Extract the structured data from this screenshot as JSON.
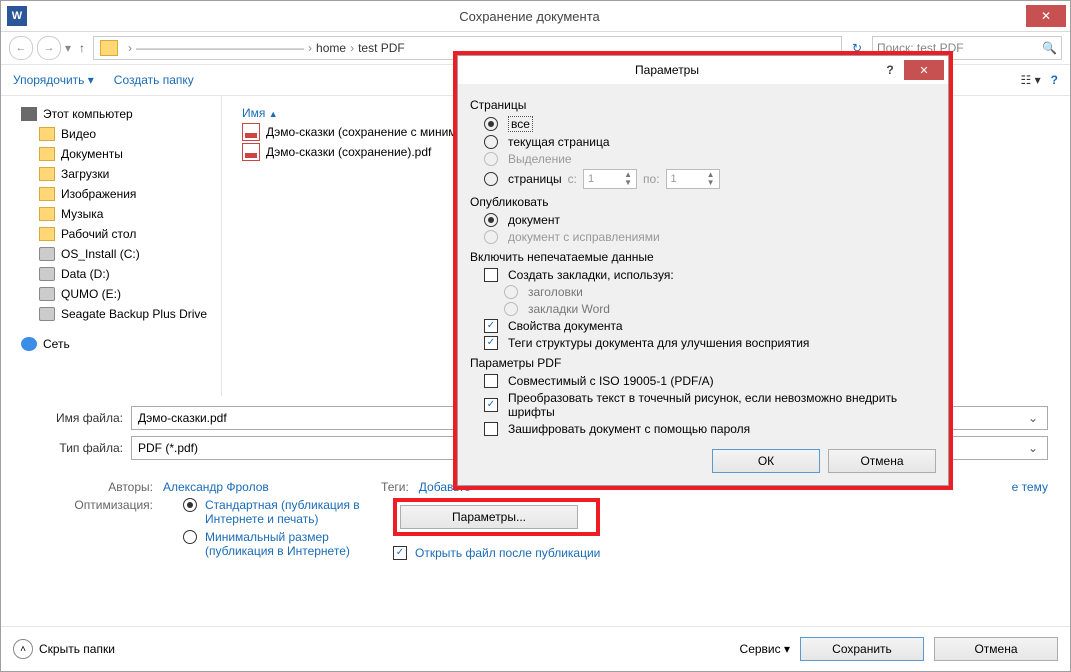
{
  "window": {
    "title": "Сохранение документа"
  },
  "nav": {
    "path_crumbs": [
      "home",
      "test PDF"
    ],
    "search_placeholder": "Поиск: test PDF"
  },
  "toolbar": {
    "organize": "Упорядочить",
    "new_folder": "Создать папку"
  },
  "tree": {
    "root": "Этот компьютер",
    "items": [
      "Видео",
      "Документы",
      "Загрузки",
      "Изображения",
      "Музыка",
      "Рабочий стол",
      "OS_Install (C:)",
      "Data (D:)",
      "QUMO (E:)",
      "Seagate Backup Plus Drive"
    ],
    "network": "Сеть"
  },
  "list": {
    "col_name": "Имя",
    "files": [
      "Дэмо-сказки (сохранение с миним",
      "Дэмо-сказки (сохранение).pdf"
    ]
  },
  "form": {
    "filename_label": "Имя файла:",
    "filename": "Дэмо-сказки.pdf",
    "filetype_label": "Тип файла:",
    "filetype": "PDF (*.pdf)",
    "authors_label": "Авторы:",
    "authors": "Александр Фролов",
    "tags_label": "Теги:",
    "tags": "Добавьте",
    "title_label": "",
    "title_value": "е тему",
    "optimize_label": "Оптимизация:",
    "opt_standard": "Стандартная (публикация в Интернете и печать)",
    "opt_min": "Минимальный размер (публикация в Интернете)",
    "params_button": "Параметры...",
    "open_after": "Открыть файл после публикации"
  },
  "footer": {
    "hide": "Скрыть папки",
    "tools": "Сервис",
    "save": "Сохранить",
    "cancel": "Отмена"
  },
  "modal": {
    "title": "Параметры",
    "pages_group": "Страницы",
    "all": "все",
    "current": "текущая страница",
    "selection": "Выделение",
    "pages": "страницы",
    "from": "с:",
    "to": "по:",
    "page_from": "1",
    "page_to": "1",
    "publish_group": "Опубликовать",
    "doc": "документ",
    "doc_rev": "документ с исправлениями",
    "nonprint_group": "Включить непечатаемые данные",
    "bookmarks": "Создать закладки, используя:",
    "headings": "заголовки",
    "word_bm": "закладки Word",
    "props": "Свойства документа",
    "tags": "Теги структуры документа для улучшения восприятия",
    "pdf_group": "Параметры PDF",
    "iso": "Совместимый с ISO 19005-1 (PDF/A)",
    "bitmap": "Преобразовать текст в точечный рисунок, если невозможно внедрить шрифты",
    "encrypt": "Зашифровать документ с помощью пароля",
    "ok": "ОК",
    "cancel": "Отмена"
  }
}
